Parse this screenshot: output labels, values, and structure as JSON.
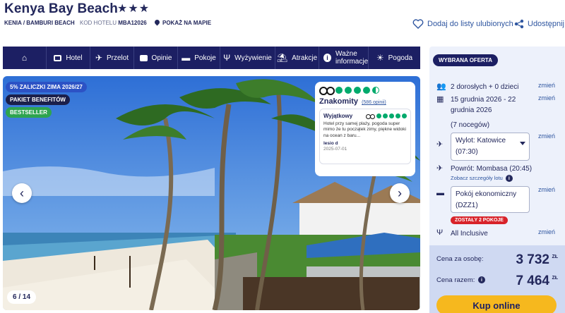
{
  "hotel": {
    "name": "Kenya Bay Beach",
    "stars": "★★★",
    "location": "KENIA / BAMBURI BEACH",
    "code_label": "KOD HOTELU",
    "code": "MBA12026",
    "map_link": "POKAŻ NA MAPIE"
  },
  "actions": {
    "favorite": "Dodaj do listy ulubionych",
    "share": "Udostępnij"
  },
  "nav": {
    "items": [
      {
        "label": "",
        "icon": "home-icon"
      },
      {
        "label": "Hotel",
        "icon": "hotel-icon"
      },
      {
        "label": "Przelot",
        "icon": "plane-icon"
      },
      {
        "label": "Opinie",
        "icon": "reviews-icon"
      },
      {
        "label": "Pokoje",
        "icon": "bed-icon"
      },
      {
        "label": "Wyżywienie",
        "icon": "cutlery-icon"
      },
      {
        "label": "Atrakcje",
        "icon": "attractions-icon"
      },
      {
        "label": "Ważne informacje",
        "icon": "info-icon"
      },
      {
        "label": "Pogoda",
        "icon": "sun-icon"
      }
    ]
  },
  "gallery": {
    "badges": [
      "5% ZALICZKI ZIMA 2026/27",
      "PAKIET BENEFITÓW",
      "BESTSELLER"
    ],
    "counter": "6 / 14"
  },
  "tripadvisor": {
    "rating_label": "Znakomity",
    "reviews_link": "(586 opinii)",
    "review": {
      "title": "Wyjątkowy",
      "text": "Hotel przy samej plaży, pogoda super mimo że tu początek zimy, piękne widoki na ocean z baru...",
      "author": "lesio d",
      "date": "2025-07-01"
    }
  },
  "offer": {
    "badge": "WYBRANA OFERTA",
    "change": "zmień",
    "travelers": "2 dorosłych + 0 dzieci",
    "dates": "15 grudnia 2026 - 22 grudnia 2026",
    "nights": "(7 nocegów)",
    "departure": "Wylot: Katowice (07:30)",
    "return": "Powrót: Mombasa (20:45)",
    "flight_details": "Zobacz szczegóły lotu",
    "room": "Pokój ekonomiczny (DZZ1)",
    "rooms_left": "ZOSTAŁY 2 POKOJE",
    "board": "All Inclusive",
    "price_per_person_label": "Cena za osobę:",
    "price_per_person": "3 732",
    "price_total_label": "Cena razem:",
    "price_total": "7 464",
    "currency": "ZŁ",
    "buy": "Kup online"
  },
  "colors": {
    "navy": "#1c1f63",
    "accent_yellow": "#f6b81e",
    "tripadvisor_green": "#00aa6c",
    "alert_red": "#d8232a"
  }
}
